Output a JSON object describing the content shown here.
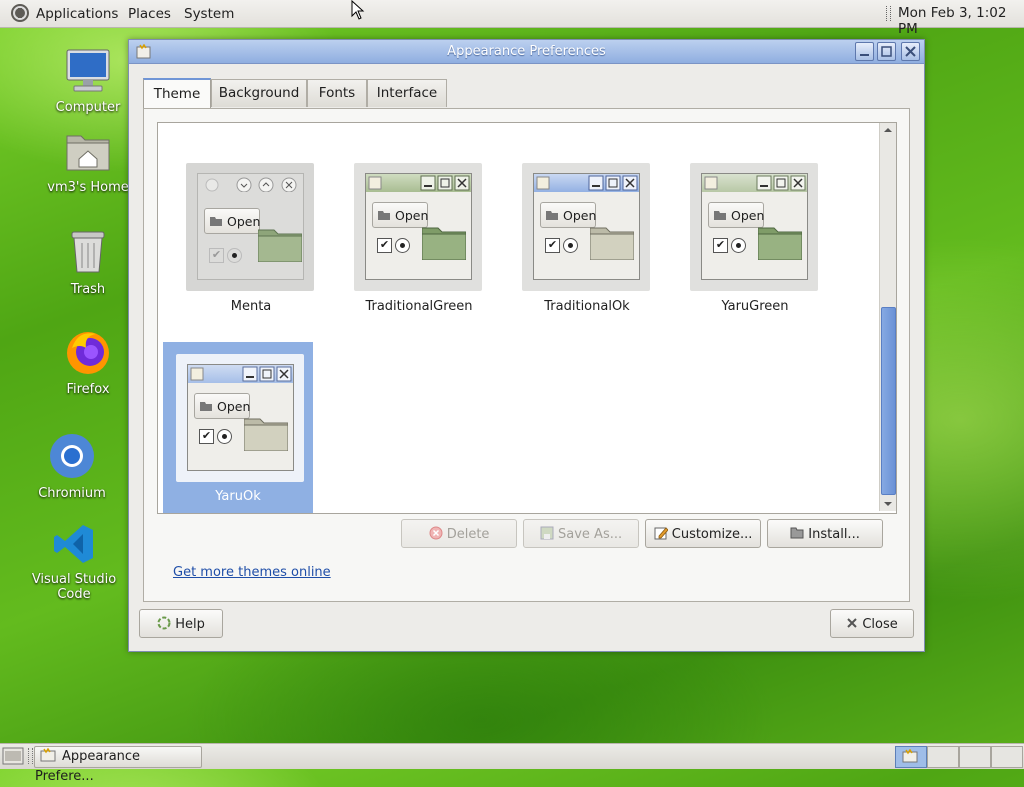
{
  "top_panel": {
    "menus": [
      "Applications",
      "Places",
      "System"
    ],
    "clock": "Mon Feb  3,  1:02 PM"
  },
  "desktop_icons": [
    {
      "label": "Computer",
      "icon": "computer-icon"
    },
    {
      "label": "vm3's Home",
      "icon": "home-folder-icon"
    },
    {
      "label": "Trash",
      "icon": "trash-icon"
    },
    {
      "label": "Firefox",
      "icon": "firefox-icon"
    },
    {
      "label": "Chromium",
      "icon": "chromium-icon"
    },
    {
      "label": "Visual Studio Code",
      "icon": "vscode-icon"
    }
  ],
  "window": {
    "title": "Appearance Preferences",
    "tabs": [
      "Theme",
      "Background",
      "Fonts",
      "Interface"
    ],
    "active_tab": "Theme",
    "themes": [
      {
        "name": "Menta",
        "style": "menta",
        "selected": false
      },
      {
        "name": "TraditionalGreen",
        "style": "traditional-green",
        "selected": false
      },
      {
        "name": "TraditionalOk",
        "style": "traditional-ok",
        "selected": false
      },
      {
        "name": "YaruGreen",
        "style": "yaru-green",
        "selected": false
      },
      {
        "name": "YaruOk",
        "style": "yaru-ok",
        "selected": true
      }
    ],
    "theme_preview_button": "Open",
    "buttons": {
      "delete": "Delete",
      "save_as": "Save As...",
      "customize": "Customize...",
      "install": "Install...",
      "help": "Help",
      "close": "Close"
    },
    "more_themes_link": "Get more themes online"
  },
  "bottom_panel": {
    "task_label": "Appearance Prefere..."
  },
  "colors": {
    "selection": "#8fb0e3",
    "titlebar": "#8faee0",
    "desktop": "#5cb01a"
  }
}
